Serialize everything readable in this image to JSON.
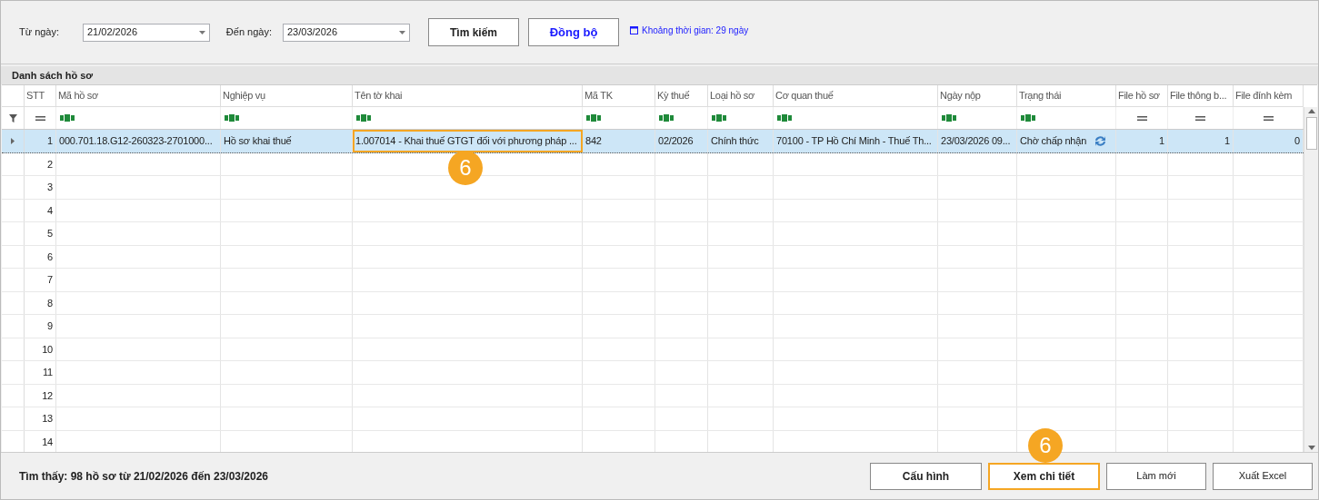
{
  "filters": {
    "from_label": "Từ ngày:",
    "from_value": "21/02/2026",
    "to_label": "Đến ngày:",
    "to_value": "23/03/2026",
    "search_button": "Tìm kiếm",
    "sync_button": "Đồng bộ",
    "range_text": "Khoảng thời gian: 29 ngày"
  },
  "grid": {
    "title": "Danh sách hồ sơ",
    "columns": [
      {
        "label": "STT",
        "filter": {
          "kind": "equals"
        }
      },
      {
        "label": "Mã hồ sơ",
        "filter": {
          "kind": "text"
        }
      },
      {
        "label": "Nghiệp vụ",
        "filter": {
          "kind": "text"
        }
      },
      {
        "label": "Tên tờ khai",
        "filter": {
          "kind": "text"
        }
      },
      {
        "label": "Mã TK",
        "filter": {
          "kind": "text"
        }
      },
      {
        "label": "Kỳ thuế",
        "filter": {
          "kind": "text"
        }
      },
      {
        "label": "Loại hồ sơ",
        "filter": {
          "kind": "text"
        }
      },
      {
        "label": "Cơ quan thuế",
        "filter": {
          "kind": "text"
        }
      },
      {
        "label": "Ngày nộp",
        "filter": {
          "kind": "text"
        }
      },
      {
        "label": "Trạng thái",
        "filter": {
          "kind": "text"
        }
      },
      {
        "label": "File hồ sơ",
        "filter": {
          "kind": "equals"
        }
      },
      {
        "label": "File thông b...",
        "filter": {
          "kind": "equals"
        }
      },
      {
        "label": "File đính kèm",
        "filter": {
          "kind": "equals"
        }
      }
    ],
    "rows": [
      {
        "selected": true,
        "sync_icon": true,
        "cells": [
          {
            "text": "1",
            "highlighted": false
          },
          {
            "text": "000.701.18.G12-260323-2701000...",
            "highlighted": false
          },
          {
            "text": "Hồ sơ khai thuế",
            "highlighted": false
          },
          {
            "text": "1.007014 - Khai thuế GTGT đối với phương pháp ...",
            "highlighted": true,
            "badge": "6"
          },
          {
            "text": "842",
            "highlighted": false
          },
          {
            "text": "02/2026",
            "highlighted": false
          },
          {
            "text": "Chính thức",
            "highlighted": false
          },
          {
            "text": "70100 - TP Hồ Chí Minh - Thuế Th...",
            "highlighted": false
          },
          {
            "text": "23/03/2026 09...",
            "highlighted": false
          },
          {
            "text": "Chờ chấp nhận",
            "highlighted": false
          },
          {
            "text": "1",
            "highlighted": false
          },
          {
            "text": "1",
            "highlighted": false
          },
          {
            "text": "0",
            "highlighted": false
          }
        ]
      },
      {
        "selected": false,
        "sync_icon": false,
        "cells": [
          {
            "text": "2",
            "highlighted": false
          }
        ]
      },
      {
        "selected": false,
        "sync_icon": false,
        "cells": [
          {
            "text": "3",
            "highlighted": false
          }
        ]
      },
      {
        "selected": false,
        "sync_icon": false,
        "cells": [
          {
            "text": "4",
            "highlighted": false
          }
        ]
      },
      {
        "selected": false,
        "sync_icon": false,
        "cells": [
          {
            "text": "5",
            "highlighted": false
          }
        ]
      },
      {
        "selected": false,
        "sync_icon": false,
        "cells": [
          {
            "text": "6",
            "highlighted": false
          }
        ]
      },
      {
        "selected": false,
        "sync_icon": false,
        "cells": [
          {
            "text": "7",
            "highlighted": false
          }
        ]
      },
      {
        "selected": false,
        "sync_icon": false,
        "cells": [
          {
            "text": "8",
            "highlighted": false
          }
        ]
      },
      {
        "selected": false,
        "sync_icon": false,
        "cells": [
          {
            "text": "9",
            "highlighted": false
          }
        ]
      },
      {
        "selected": false,
        "sync_icon": false,
        "cells": [
          {
            "text": "10",
            "highlighted": false
          }
        ]
      },
      {
        "selected": false,
        "sync_icon": false,
        "cells": [
          {
            "text": "11",
            "highlighted": false
          }
        ]
      },
      {
        "selected": false,
        "sync_icon": false,
        "cells": [
          {
            "text": "12",
            "highlighted": false
          }
        ]
      },
      {
        "selected": false,
        "sync_icon": false,
        "cells": [
          {
            "text": "13",
            "highlighted": false
          }
        ]
      },
      {
        "selected": false,
        "sync_icon": false,
        "cells": [
          {
            "text": "14",
            "highlighted": false
          }
        ]
      }
    ]
  },
  "footer": {
    "summary": "Tìm thấy: 98 hồ sơ từ 21/02/2026 đến 23/03/2026",
    "buttons": [
      {
        "label": "Cấu hình",
        "highlighted": false
      },
      {
        "label": "Xem chi tiết",
        "highlighted": true,
        "badge": "6"
      },
      {
        "label": "Làm mới",
        "highlighted": false
      },
      {
        "label": "Xuất Excel",
        "highlighted": false
      }
    ]
  }
}
